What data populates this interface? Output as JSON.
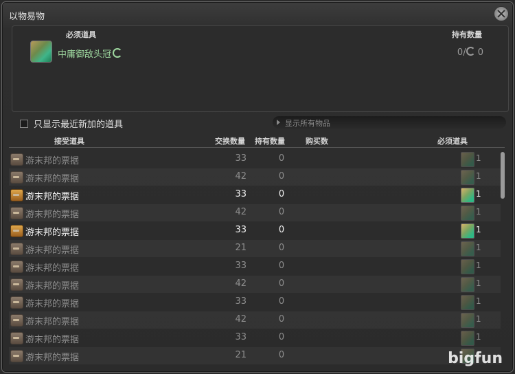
{
  "window": {
    "title": "以物易物"
  },
  "required": {
    "header_item": "必须道具",
    "header_owned": "持有数量",
    "item_name": "中庸御敌头冠",
    "owned_text": "0/",
    "owned_suffix": "0"
  },
  "filter": {
    "checkbox_label": "只显示最近新加的道具",
    "dropdown_label": "显示所有物品"
  },
  "columns": {
    "receive": "接受道具",
    "exchange_qty": "交换数量",
    "owned": "持有数量",
    "buy": "购买数",
    "required": "必须道具"
  },
  "rows": [
    {
      "name": "游末邦的票据",
      "qty": "33",
      "owned": "0",
      "req": "1",
      "active": false
    },
    {
      "name": "游末邦的票据",
      "qty": "42",
      "owned": "0",
      "req": "1",
      "active": false
    },
    {
      "name": "游末邦的票据",
      "qty": "33",
      "owned": "0",
      "req": "1",
      "active": true
    },
    {
      "name": "游末邦的票据",
      "qty": "42",
      "owned": "0",
      "req": "1",
      "active": false
    },
    {
      "name": "游末邦的票据",
      "qty": "33",
      "owned": "0",
      "req": "1",
      "active": true
    },
    {
      "name": "游末邦的票据",
      "qty": "21",
      "owned": "0",
      "req": "1",
      "active": false
    },
    {
      "name": "游末邦的票据",
      "qty": "33",
      "owned": "0",
      "req": "1",
      "active": false
    },
    {
      "name": "游末邦的票据",
      "qty": "42",
      "owned": "0",
      "req": "1",
      "active": false
    },
    {
      "name": "游末邦的票据",
      "qty": "33",
      "owned": "0",
      "req": "1",
      "active": false
    },
    {
      "name": "游末邦的票据",
      "qty": "42",
      "owned": "0",
      "req": "1",
      "active": false
    },
    {
      "name": "游末邦的票据",
      "qty": "33",
      "owned": "0",
      "req": "1",
      "active": false
    },
    {
      "name": "游末邦的票据",
      "qty": "21",
      "owned": "0",
      "req": "1",
      "active": false
    }
  ],
  "watermark": "bigfun"
}
